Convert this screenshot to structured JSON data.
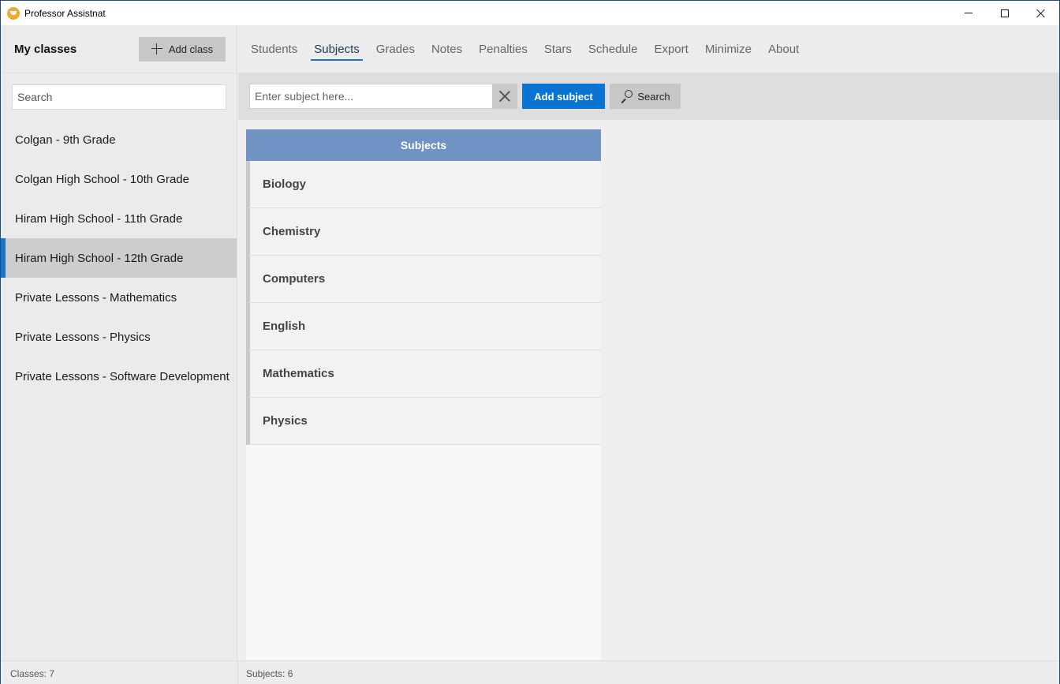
{
  "window": {
    "title": "Professor Assistnat",
    "icon": "app-logo-icon"
  },
  "sidebar": {
    "title": "My classes",
    "add_class_label": "Add class",
    "search_placeholder": "Search",
    "classes": [
      {
        "label": "Colgan - 9th Grade",
        "selected": false
      },
      {
        "label": "Colgan High School - 10th Grade",
        "selected": false
      },
      {
        "label": "Hiram High School - 11th Grade",
        "selected": false
      },
      {
        "label": "Hiram High School - 12th Grade",
        "selected": true
      },
      {
        "label": "Private Lessons - Mathematics",
        "selected": false
      },
      {
        "label": "Private Lessons - Physics",
        "selected": false
      },
      {
        "label": "Private Lessons - Software Development",
        "selected": false
      }
    ]
  },
  "tabs": [
    {
      "label": "Students",
      "active": false
    },
    {
      "label": "Subjects",
      "active": true
    },
    {
      "label": "Grades",
      "active": false
    },
    {
      "label": "Notes",
      "active": false
    },
    {
      "label": "Penalties",
      "active": false
    },
    {
      "label": "Stars",
      "active": false
    },
    {
      "label": "Schedule",
      "active": false
    },
    {
      "label": "Export",
      "active": false
    },
    {
      "label": "Minimize",
      "active": false
    },
    {
      "label": "About",
      "active": false
    }
  ],
  "toolbar": {
    "subject_placeholder": "Enter subject here...",
    "subject_value": "",
    "add_subject_label": "Add subject",
    "search_label": "Search"
  },
  "subjects": {
    "header": "Subjects",
    "items": [
      "Biology",
      "Chemistry",
      "Computers",
      "English",
      "Mathematics",
      "Physics"
    ]
  },
  "status": {
    "classes": "Classes: 7",
    "subjects": "Subjects: 6"
  },
  "colors": {
    "accent": "#0a74d4",
    "selection_bar": "#1a73c8",
    "table_header": "#7093c3"
  }
}
